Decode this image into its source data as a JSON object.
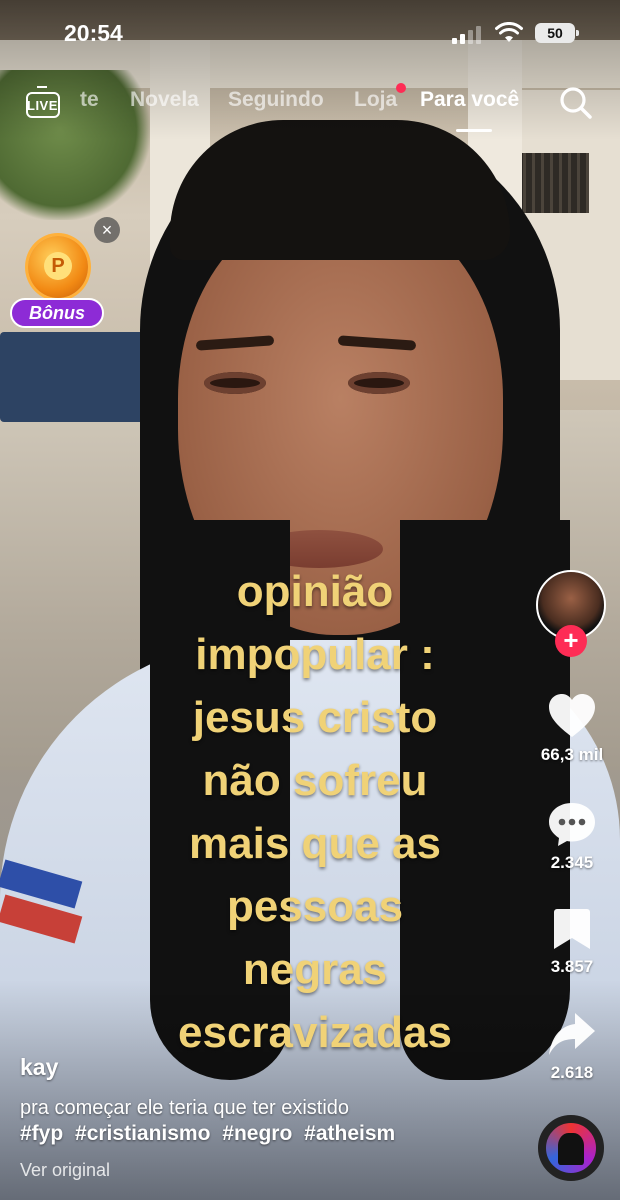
{
  "status_bar": {
    "time": "20:54",
    "battery": "50"
  },
  "top_nav": {
    "live_label": "LIVE",
    "tabs": [
      {
        "label": "te"
      },
      {
        "label": "Novela"
      },
      {
        "label": "Seguindo"
      },
      {
        "label": "Loja"
      },
      {
        "label": "Para você"
      }
    ],
    "active_tab": "Para você"
  },
  "bonus": {
    "coin_letter": "P",
    "label": "Bônus"
  },
  "caption": {
    "lines": [
      "opinião",
      "impopular :",
      "jesus cristo",
      "não sofreu",
      "mais que as",
      "pessoas",
      "negras",
      "escravizadas"
    ]
  },
  "rail": {
    "likes": "66,3 mil",
    "comments": "2.345",
    "saves": "3.857",
    "shares": "2.618"
  },
  "post": {
    "author": "kay",
    "description": "pra começar ele teria que ter existido",
    "hashtags": [
      "#fyp",
      "#cristianismo",
      "#negro",
      "#atheism"
    ],
    "translate_link": "Ver original"
  },
  "colors": {
    "caption": "#f0d277",
    "accent_red": "#fe2c55",
    "bonus_purple": "#8d2bd6"
  }
}
